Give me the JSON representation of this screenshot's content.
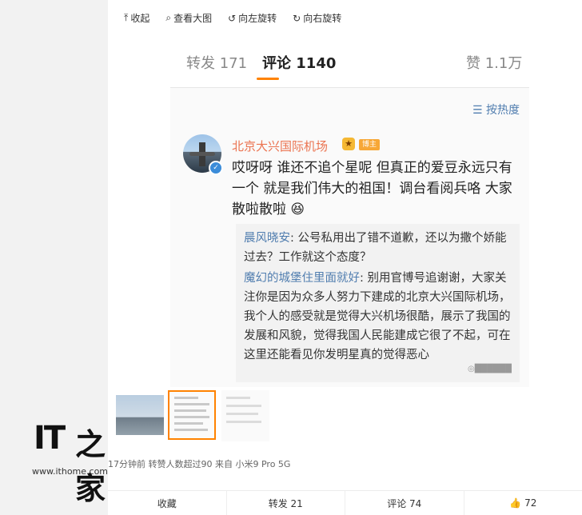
{
  "toolbar": {
    "collect": "收起",
    "view_large": "查看大图",
    "rotate_left": "向左旋转",
    "rotate_right": "向右旋转"
  },
  "screenshot": {
    "tabs": {
      "repost": "转发 171",
      "comments": "评论 1140",
      "likes": "赞 1.1万"
    },
    "sort_label": "按热度",
    "author": "北京大兴国际机场",
    "owner_badge": "博主",
    "comment_text": "哎呀呀 谁还不追个星呢 但真正的爱豆永远只有一个 就是我们伟大的祖国！调台看阅兵咯 大家散啦散啦",
    "replies": [
      {
        "user": "晨风晓安",
        "text": "公号私用出了错不道歉，还以为撒个娇能过去？工作就这个态度？"
      },
      {
        "user": "魔幻的城堡住里面就好",
        "text": "别用官博号追谢谢，大家关注你是因为众多人努力下建成的北京大兴国际机场，我个人的感受就是觉得大兴机场很酷，展示了我国的发展和风貌，觉得我国人民能建成它很了不起，可在这里还能看见你发明星真的觉得恶心"
      }
    ]
  },
  "logo": {
    "it": "IT",
    "zh": "之家",
    "site": "www.ithome.com"
  },
  "meta": "17分钟前  转赞人数超过90  来自 小米9 Pro 5G",
  "actions": {
    "collect": "收藏",
    "repost": "转发 21",
    "comment": "评论 74",
    "like": "72"
  },
  "colors": {
    "accent": "#ff8200",
    "username": "#eb7350",
    "link": "#507daf"
  }
}
